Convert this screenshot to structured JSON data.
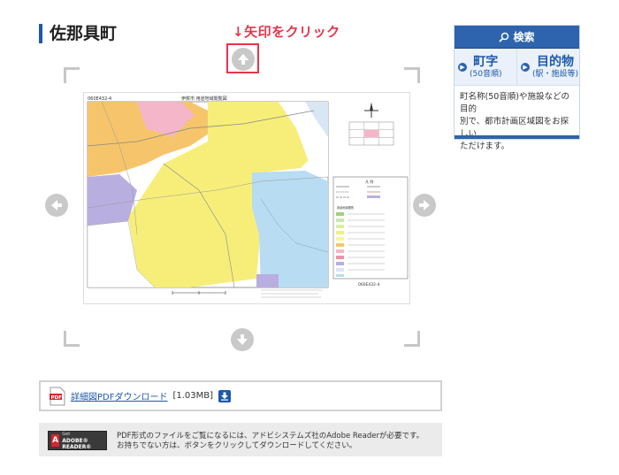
{
  "page": {
    "title": "佐那具町"
  },
  "annotation": {
    "text": "↓矢印をクリック"
  },
  "nav": {
    "up": "arrow-up-icon",
    "down": "arrow-down-icon",
    "left": "arrow-left-icon",
    "right": "arrow-right-icon"
  },
  "map": {
    "sheet_code_top": "060E432-4",
    "sheet_title": "伊賀市 用途地域閲覧図",
    "sheet_code_bottom": "060E432-4",
    "legend_title": "凡 例",
    "legend_subtitle": "用途地域種別"
  },
  "search": {
    "header": "検索",
    "col1": {
      "main": "町字",
      "sub": "(50音順)"
    },
    "col2": {
      "main": "目的物",
      "sub": "(駅・施設等)"
    },
    "description_lines": [
      "町名称(50音順)や施設などの目的",
      "別で、都市計画区域図をお探しい",
      "ただけます。"
    ]
  },
  "download": {
    "link_text": "詳細図PDFダウンロード",
    "size_text": "[1.03MB]"
  },
  "adobe": {
    "badge_line1": "Get",
    "badge_line2": "ADOBE® READER®",
    "text_line1": "PDF形式のファイルをご覧になるには、アドビシステムズ社のAdobe Readerが必要です。",
    "text_line2": "お持ちでない方は、ボタンをクリックしてダウンロードしてください。"
  },
  "colors": {
    "accent": "#1e5aa8",
    "annotation": "#e8334a",
    "zone_yellow": "#f7ee7a",
    "zone_orange": "#f6c56b",
    "zone_blue": "#b8dcf2",
    "zone_purple": "#b9aee0",
    "zone_pink": "#f4b6c8"
  }
}
